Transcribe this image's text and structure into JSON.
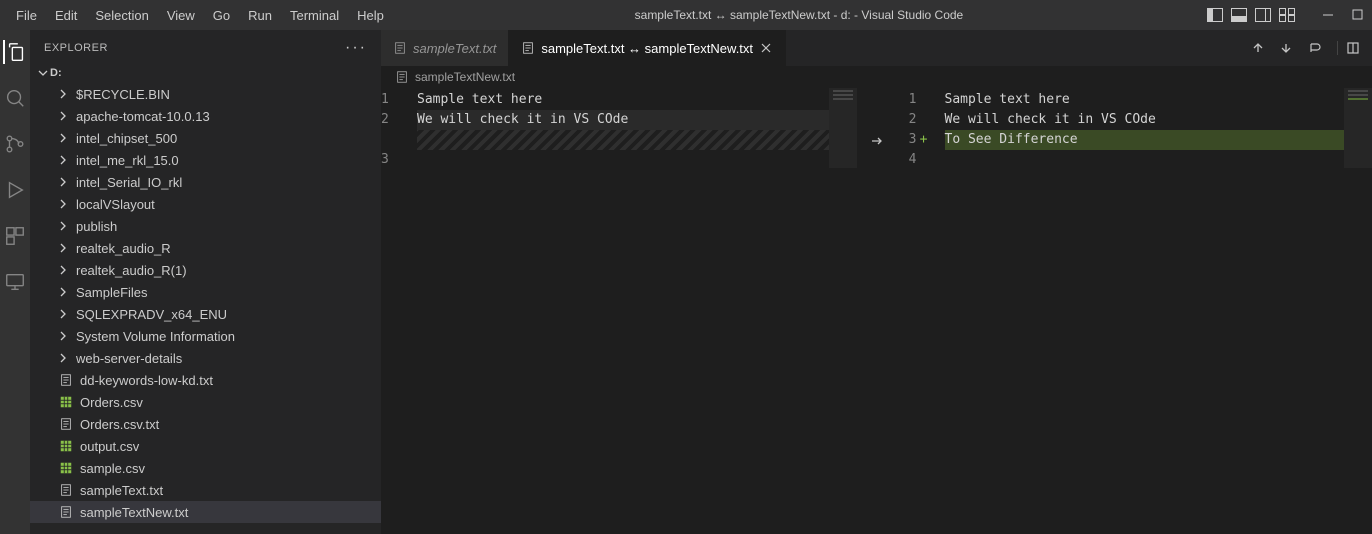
{
  "menubar": {
    "items": [
      "File",
      "Edit",
      "Selection",
      "View",
      "Go",
      "Run",
      "Terminal",
      "Help"
    ],
    "title": "sampleText.txt ↔ sampleTextNew.txt - d: - Visual Studio Code"
  },
  "sidebar": {
    "title": "EXPLORER",
    "drive": "D:",
    "items": [
      {
        "type": "folder",
        "label": "$RECYCLE.BIN"
      },
      {
        "type": "folder",
        "label": "apache-tomcat-10.0.13"
      },
      {
        "type": "folder",
        "label": "intel_chipset_500"
      },
      {
        "type": "folder",
        "label": "intel_me_rkl_15.0"
      },
      {
        "type": "folder",
        "label": "intel_Serial_IO_rkl"
      },
      {
        "type": "folder",
        "label": "localVSlayout"
      },
      {
        "type": "folder",
        "label": "publish"
      },
      {
        "type": "folder",
        "label": "realtek_audio_R"
      },
      {
        "type": "folder",
        "label": "realtek_audio_R(1)"
      },
      {
        "type": "folder",
        "label": "SampleFiles"
      },
      {
        "type": "folder",
        "label": "SQLEXPRADV_x64_ENU"
      },
      {
        "type": "folder",
        "label": "System Volume Information"
      },
      {
        "type": "folder",
        "label": "web-server-details"
      },
      {
        "type": "file-txt",
        "label": "dd-keywords-low-kd.txt"
      },
      {
        "type": "file-csv",
        "label": "Orders.csv"
      },
      {
        "type": "file-txt",
        "label": "Orders.csv.txt"
      },
      {
        "type": "file-csv",
        "label": "output.csv"
      },
      {
        "type": "file-csv",
        "label": "sample.csv"
      },
      {
        "type": "file-txt",
        "label": "sampleText.txt"
      },
      {
        "type": "file-txt",
        "label": "sampleTextNew.txt",
        "selected": true
      }
    ]
  },
  "tabs": {
    "inactive": "sampleText.txt",
    "active": "sampleText.txt ↔ sampleTextNew.txt"
  },
  "breadcrumb": "sampleTextNew.txt",
  "diff": {
    "left_lines": [
      {
        "n": "1",
        "text": "Sample text here"
      },
      {
        "n": "2",
        "text": "We will check it in VS COde",
        "current": true
      },
      {
        "n": "",
        "text": "",
        "hatched": true
      },
      {
        "n": "3",
        "text": ""
      }
    ],
    "right_lines": [
      {
        "n": "1",
        "marker": "",
        "text": "Sample text here"
      },
      {
        "n": "2",
        "marker": "",
        "text": "We will check it in VS COde"
      },
      {
        "n": "3",
        "marker": "+",
        "text": "To See Difference",
        "added": true
      },
      {
        "n": "4",
        "marker": "",
        "text": ""
      }
    ]
  }
}
